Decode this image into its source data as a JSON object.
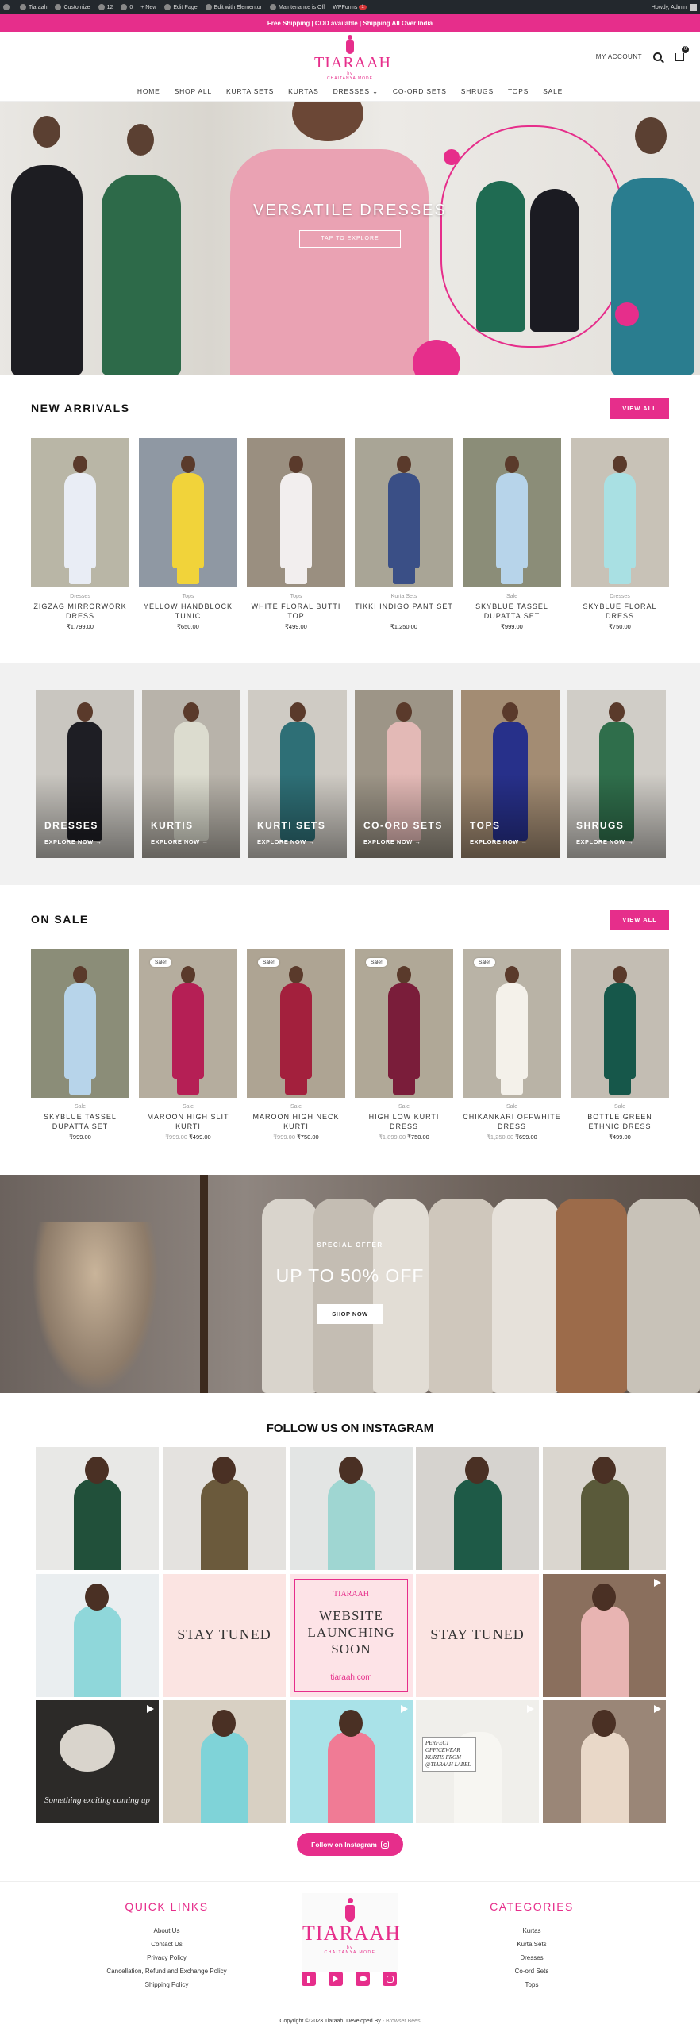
{
  "adminbar": {
    "items": [
      {
        "label": "Tiaraah"
      },
      {
        "label": "Customize"
      },
      {
        "label": "12"
      },
      {
        "label": "0"
      },
      {
        "label": "+ New"
      },
      {
        "label": "Edit Page"
      },
      {
        "label": "Edit with Elementor"
      },
      {
        "label": "Maintenance is Off"
      },
      {
        "label": "WPForms",
        "badge": "1"
      }
    ],
    "howdy": "Howdy, Admin"
  },
  "promo": "Free Shipping | COD available | Shipping All Over India",
  "header": {
    "logo_name": "TIARAAH",
    "logo_by": "by",
    "logo_sub": "CHAITANYA MODE",
    "account": "MY ACCOUNT",
    "cart_count": "0",
    "nav": [
      "HOME",
      "SHOP ALL",
      "KURTA SETS",
      "KURTAS",
      "DRESSES ⌄",
      "CO-ORD SETS",
      "SHRUGS",
      "TOPS",
      "SALE"
    ]
  },
  "hero": {
    "title": "VERSATILE DRESSES",
    "button": "TAP TO EXPLORE"
  },
  "new_arrivals": {
    "title": "NEW ARRIVALS",
    "view_all": "VIEW ALL",
    "products": [
      {
        "cat": "Dresses",
        "name": "ZIGZAG MIRRORWORK DRESS",
        "price": "₹1,799.00",
        "bg": "#b9b6a6",
        "dress": "#e9edf5"
      },
      {
        "cat": "Tops",
        "name": "YELLOW HANDBLOCK TUNIC",
        "price": "₹650.00",
        "bg": "#8f98a3",
        "dress": "#f1d33a"
      },
      {
        "cat": "Tops",
        "name": "WHITE FLORAL BUTTI TOP",
        "price": "₹499.00",
        "bg": "#9a8f80",
        "dress": "#f2eeee"
      },
      {
        "cat": "Kurta Sets",
        "name": "TIKKI INDIGO PANT SET",
        "price": "₹1,250.00",
        "bg": "#a9a596",
        "dress": "#3a4f86"
      },
      {
        "cat": "Sale",
        "name": "SKYBLUE TASSEL DUPATTA SET",
        "price": "₹999.00",
        "bg": "#8b8d78",
        "dress": "#b7d4ea"
      },
      {
        "cat": "Dresses",
        "name": "SKYBLUE FLORAL DRESS",
        "price": "₹750.00",
        "bg": "#c8c2b7",
        "dress": "#a9e0e3"
      }
    ]
  },
  "categories": [
    {
      "name": "DRESSES",
      "explore": "EXPLORE NOW →",
      "bg": "#c9c6c0",
      "dress": "#1e1e24"
    },
    {
      "name": "KURTIS",
      "explore": "EXPLORE NOW →",
      "bg": "#b8b3aa",
      "dress": "#dcdccf"
    },
    {
      "name": "KURTI SETS",
      "explore": "EXPLORE NOW →",
      "bg": "#cfcbc4",
      "dress": "#2e6f76"
    },
    {
      "name": "CO-ORD SETS",
      "explore": "EXPLORE NOW →",
      "bg": "#9d9587",
      "dress": "#e3b9b6"
    },
    {
      "name": "TOPS",
      "explore": "EXPLORE NOW →",
      "bg": "#a38c73",
      "dress": "#27308a"
    },
    {
      "name": "SHRUGS",
      "explore": "EXPLORE NOW →",
      "bg": "#d0cdc7",
      "dress": "#2f6e4b"
    }
  ],
  "on_sale": {
    "title": "ON SALE",
    "view_all": "VIEW ALL",
    "sale_badge": "Sale!",
    "products": [
      {
        "cat": "Sale",
        "name": "SKYBLUE TASSEL DUPATTA SET",
        "old": "",
        "price": "₹999.00",
        "badge": false,
        "bg": "#8b8d78",
        "dress": "#b7d4ea"
      },
      {
        "cat": "Sale",
        "name": "MAROON HIGH SLIT KURTI",
        "old": "₹999.00",
        "price": "₹499.00",
        "badge": true,
        "bg": "#b5ad9e",
        "dress": "#b51f55"
      },
      {
        "cat": "Sale",
        "name": "MAROON HIGH NECK KURTI",
        "old": "₹999.00",
        "price": "₹750.00",
        "badge": true,
        "bg": "#aea493",
        "dress": "#a3203d"
      },
      {
        "cat": "Sale",
        "name": "HIGH LOW KURTI DRESS",
        "old": "₹1,899.00",
        "price": "₹750.00",
        "badge": true,
        "bg": "#b0a897",
        "dress": "#7a1d3a"
      },
      {
        "cat": "Sale",
        "name": "CHIKANKARI OFFWHITE DRESS",
        "old": "₹1,250.00",
        "price": "₹699.00",
        "badge": true,
        "bg": "#b9b3a6",
        "dress": "#f4f1ea"
      },
      {
        "cat": "Sale",
        "name": "BOTTLE GREEN ETHNIC DRESS",
        "old": "",
        "price": "₹499.00",
        "badge": false,
        "bg": "#c3bdb3",
        "dress": "#16574a"
      }
    ]
  },
  "offer": {
    "subtitle": "SPECIAL OFFER",
    "title": "UP TO 50% OFF",
    "button": "SHOP NOW"
  },
  "instagram": {
    "title": "FOLLOW US ON INSTAGRAM",
    "button": "Follow on Instagram",
    "tiles": [
      {
        "kind": "person",
        "bg": "#e8e8e6",
        "dress": "#21503a",
        "text": ""
      },
      {
        "kind": "person",
        "bg": "#e4e2df",
        "dress": "#6b5a3c",
        "text": ""
      },
      {
        "kind": "person",
        "bg": "#e3e5e4",
        "dress": "#9fd6d2",
        "text": ""
      },
      {
        "kind": "person",
        "bg": "#d6d3cf",
        "dress": "#1e5a47",
        "text": ""
      },
      {
        "kind": "person",
        "bg": "#dad6cf",
        "dress": "#5a5a3a",
        "text": ""
      },
      {
        "kind": "person",
        "bg": "#eaeef0",
        "dress": "#8fd7da",
        "text": ""
      },
      {
        "kind": "text",
        "bg": "#fbe4e2",
        "dress": "",
        "text": "STAY TUNED"
      },
      {
        "kind": "launch",
        "bg": "#fde3e7",
        "dress": "",
        "text": "WEBSITE LAUNCHING SOON",
        "url": "tiaraah.com",
        "brand": "TIARAAH"
      },
      {
        "kind": "text",
        "bg": "#fbe4e2",
        "dress": "",
        "text": "STAY TUNED"
      },
      {
        "kind": "person",
        "bg": "#8a6f5d",
        "dress": "#e8b4b2",
        "text": "",
        "video": true
      },
      {
        "kind": "caption",
        "bg": "#2c2a28",
        "dress": "",
        "text": "Something exciting coming up",
        "video": true
      },
      {
        "kind": "person",
        "bg": "#d8d0c3",
        "dress": "#7fd3d8",
        "text": ""
      },
      {
        "kind": "person",
        "bg": "#a9e2e8",
        "dress": "#f07b95",
        "text": "",
        "video": true
      },
      {
        "kind": "note",
        "bg": "#f0efeb",
        "dress": "#f7f6f2",
        "text": "PERFECT OFFICEWEAR KURTIS FROM @TIARAAH LABEL",
        "video": true
      },
      {
        "kind": "person",
        "bg": "#9a8677",
        "dress": "#e9d8c8",
        "text": "",
        "video": true
      }
    ]
  },
  "footer": {
    "quick_title": "QUICK LINKS",
    "quick_links": [
      "About Us",
      "Contact Us",
      "Privacy Policy",
      "Cancellation, Refund and Exchange Policy",
      "Shipping Policy"
    ],
    "cat_title": "CATEGORIES",
    "cat_links": [
      "Kurtas",
      "Kurta Sets",
      "Dresses",
      "Co-ord Sets",
      "Tops"
    ],
    "logo_name": "TIARAAH",
    "logo_by": "by",
    "logo_sub": "CHAITANYA MODE",
    "social": [
      "facebook-icon",
      "youtube-icon",
      "twitter-icon",
      "instagram-icon"
    ],
    "copyright": "Copyright © 2023 Tiaraah. Developed By",
    "developer": "- Browser Bees"
  },
  "colors": {
    "brand": "#e62e8b",
    "admin_bar": "#23282d"
  }
}
